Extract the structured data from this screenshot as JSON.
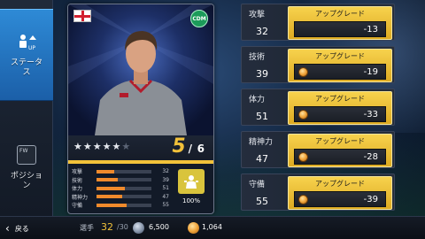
{
  "nav": {
    "status_label": "ステータス",
    "position_label": "ポジション",
    "position_icon_text": "FW"
  },
  "card": {
    "flag": "england-flag",
    "position_badge": "CDM",
    "stars_filled": 5,
    "stars_total": 6,
    "level_current": "5",
    "level_sep": "/",
    "level_max": "6",
    "overall_pct": "100%",
    "mini_stats": [
      {
        "label": "攻撃",
        "value": "32",
        "fraction": 0.32
      },
      {
        "label": "技術",
        "value": "39",
        "fraction": 0.39
      },
      {
        "label": "体力",
        "value": "51",
        "fraction": 0.51
      },
      {
        "label": "精神力",
        "value": "47",
        "fraction": 0.47
      },
      {
        "label": "守備",
        "value": "55",
        "fraction": 0.55
      }
    ]
  },
  "stats": [
    {
      "name": "攻撃",
      "value": "32",
      "button": "アップグレード",
      "cost": "-13"
    },
    {
      "name": "技術",
      "value": "39",
      "button": "アップグレード",
      "cost": "-19"
    },
    {
      "name": "体力",
      "value": "51",
      "button": "アップグレード",
      "cost": "-33"
    },
    {
      "name": "精神力",
      "value": "47",
      "button": "アップグレード",
      "cost": "-28"
    },
    {
      "name": "守備",
      "value": "55",
      "button": "アップグレード",
      "cost": "-39"
    }
  ],
  "bottom": {
    "back_label": "戻る",
    "players_label": "選手",
    "players_count": "32",
    "players_max": "/30",
    "currency_a": "6,500",
    "currency_b": "1,064"
  },
  "colors": {
    "accent_blue": "#2e8ad6",
    "upgrade_gold": "#f2c23a",
    "bar_orange": "#f08a2c",
    "badge_green": "#1c9b5a"
  }
}
